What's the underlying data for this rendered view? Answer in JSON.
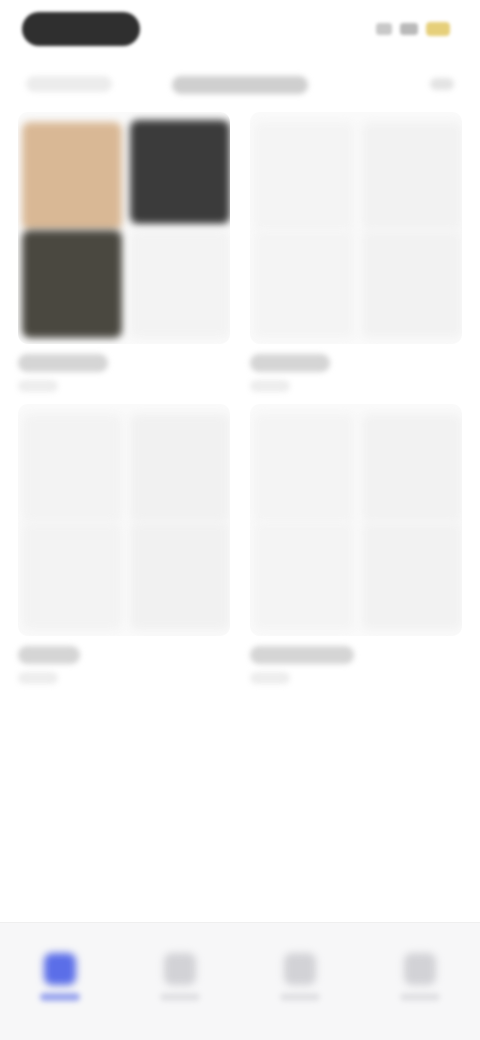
{
  "status_bar": {
    "time": "",
    "battery_color": "#e6cf7a"
  },
  "header": {
    "back_label": "",
    "title": "",
    "more_label": ""
  },
  "albums": [
    {
      "title": "",
      "count": ""
    },
    {
      "title": "",
      "count": ""
    },
    {
      "title": "",
      "count": ""
    },
    {
      "title": "",
      "count": ""
    }
  ],
  "tab_bar": {
    "active_color": "#5b6ee8",
    "inactive_color": "#d2d2d6",
    "tabs": [
      {
        "label": "",
        "icon": "photo-library-icon",
        "active": true
      },
      {
        "label": "",
        "icon": "for-you-icon",
        "active": false
      },
      {
        "label": "",
        "icon": "albums-icon",
        "active": false
      },
      {
        "label": "",
        "icon": "search-icon",
        "active": false
      }
    ]
  }
}
